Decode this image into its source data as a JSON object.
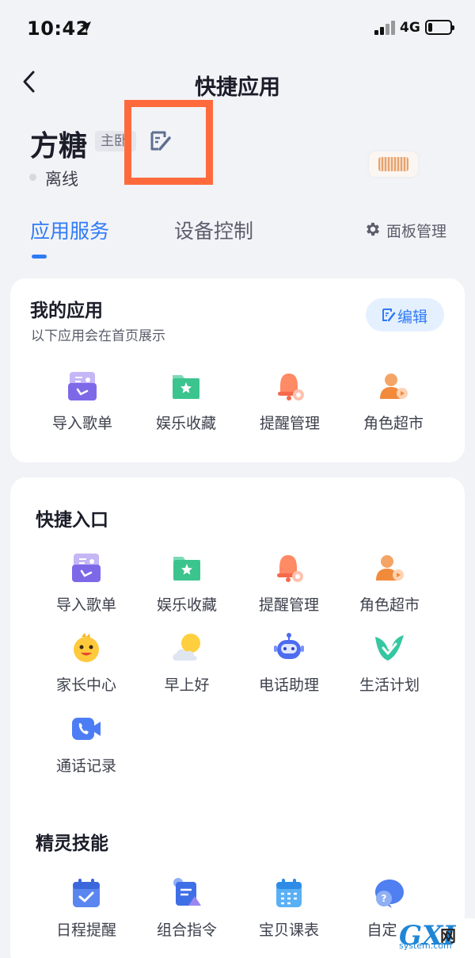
{
  "status_bar": {
    "time": "10:42",
    "network": "4G",
    "battery_level": 0.2
  },
  "nav": {
    "title": "快捷应用",
    "back_icon": "chevron-left-icon"
  },
  "device": {
    "name": "方糖",
    "room": "主卧",
    "status": "离线"
  },
  "tabs": [
    {
      "label": "应用服务",
      "active": true
    },
    {
      "label": "设备控制",
      "active": false
    }
  ],
  "panel_management": {
    "label": "面板管理",
    "icon": "gear-icon"
  },
  "my_apps": {
    "title": "我的应用",
    "subtitle": "以下应用会在首页展示",
    "edit_label": "编辑",
    "items": [
      {
        "label": "导入歌单",
        "icon": "import-playlist-icon"
      },
      {
        "label": "娱乐收藏",
        "icon": "entertainment-favorites-icon"
      },
      {
        "label": "提醒管理",
        "icon": "reminder-bell-icon"
      },
      {
        "label": "角色超市",
        "icon": "role-market-icon"
      }
    ]
  },
  "shortcuts": {
    "title": "快捷入口",
    "items": [
      {
        "label": "导入歌单",
        "icon": "import-playlist-icon"
      },
      {
        "label": "娱乐收藏",
        "icon": "entertainment-favorites-icon"
      },
      {
        "label": "提醒管理",
        "icon": "reminder-bell-icon"
      },
      {
        "label": "角色超市",
        "icon": "role-market-icon"
      },
      {
        "label": "家长中心",
        "icon": "parent-center-icon"
      },
      {
        "label": "早上好",
        "icon": "good-morning-icon"
      },
      {
        "label": "电话助理",
        "icon": "phone-assistant-robot-icon"
      },
      {
        "label": "生活计划",
        "icon": "life-plan-bird-icon"
      },
      {
        "label": "通话记录",
        "icon": "call-log-video-icon"
      }
    ]
  },
  "skills": {
    "title": "精灵技能",
    "items": [
      {
        "label": "日程提醒",
        "icon": "calendar-check-icon"
      },
      {
        "label": "组合指令",
        "icon": "combo-command-icon"
      },
      {
        "label": "宝贝课表",
        "icon": "class-schedule-icon"
      },
      {
        "label": "自定义",
        "icon": "custom-question-icon"
      }
    ]
  },
  "watermark": {
    "brand": "GXI",
    "site": "system.com",
    "suffix": "网"
  },
  "colors": {
    "accent": "#2f7bf6",
    "highlight": "#ff6a3d",
    "background": "#f2f3f7"
  }
}
